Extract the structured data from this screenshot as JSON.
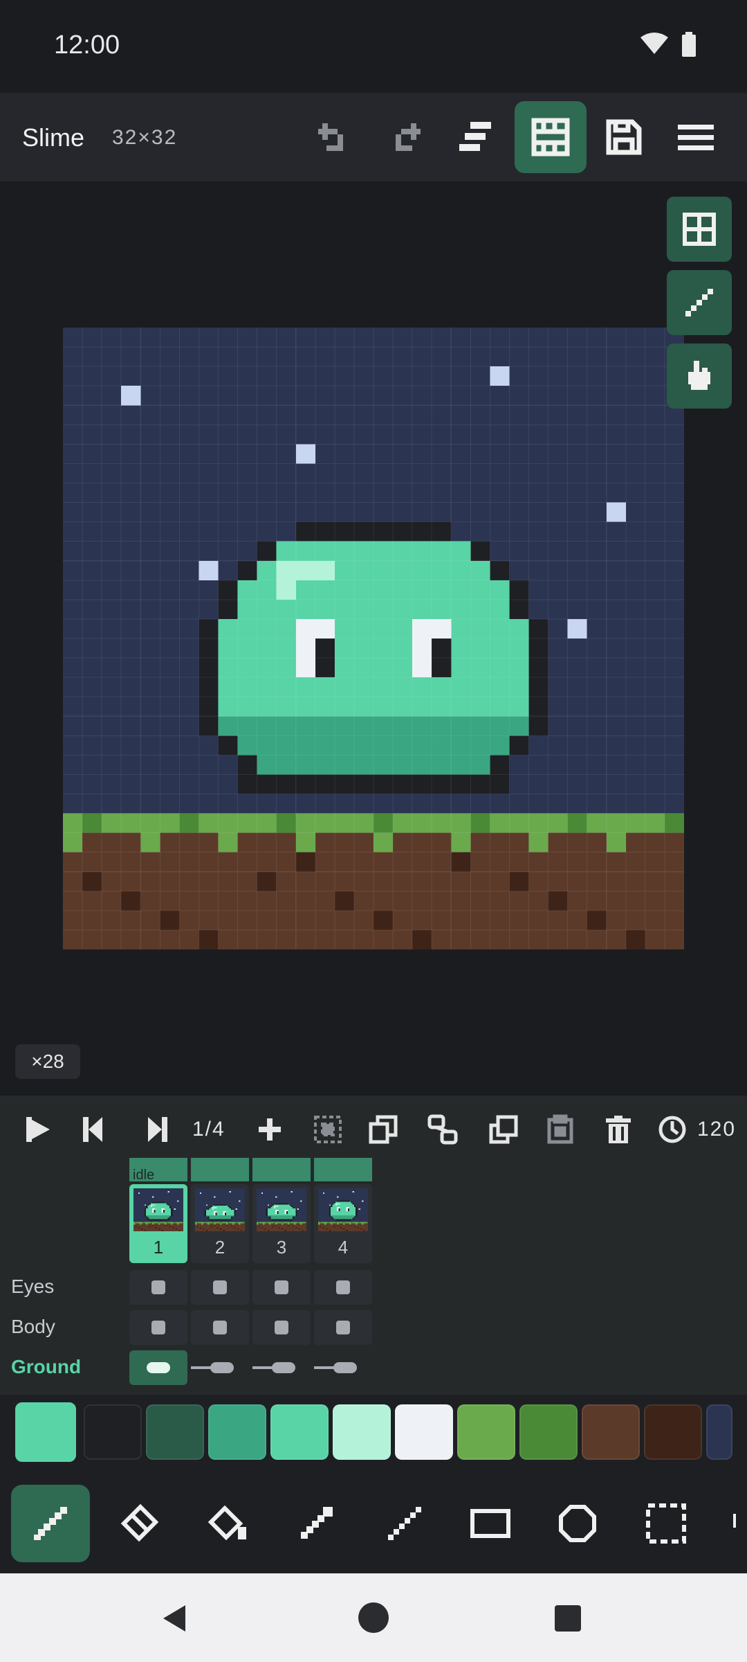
{
  "status_bar": {
    "time": "12:00"
  },
  "app_bar": {
    "title": "Slime",
    "canvas_size": "32×32"
  },
  "canvas": {
    "zoom_label": "×28"
  },
  "timeline": {
    "frame_counter": "1/4",
    "frame_duration": "120",
    "tag_label": "idle",
    "frames": [
      "1",
      "2",
      "3",
      "4"
    ],
    "layers": [
      "Eyes",
      "Body",
      "Ground"
    ],
    "active_layer": "Ground"
  },
  "colors": {
    "accent": "#58d4a6",
    "accent_dark": "#2a5a48",
    "sky": "#2b3552",
    "grass": "#6aaa4c",
    "dirt": "#5c3a2a"
  },
  "palette": [
    "#58d4a6",
    "#1e2024",
    "#2a5a48",
    "#3aa682",
    "#58d4a6",
    "#b4f2da",
    "#eef2f6",
    "#6aaa4c",
    "#4a8a36",
    "#5c3a2a",
    "#3e2418",
    "#2b3552"
  ],
  "icons": {
    "top": [
      "undo-icon",
      "redo-icon",
      "layers-icon",
      "timeline-icon",
      "save-icon",
      "menu-icon"
    ],
    "side": [
      "grid-icon",
      "line-icon",
      "hand-icon"
    ],
    "tools": [
      "pencil-icon",
      "eraser-icon",
      "fill-bucket-icon",
      "eyedropper-icon",
      "line-tool-icon",
      "rectangle-icon",
      "ellipse-icon",
      "select-icon"
    ]
  }
}
